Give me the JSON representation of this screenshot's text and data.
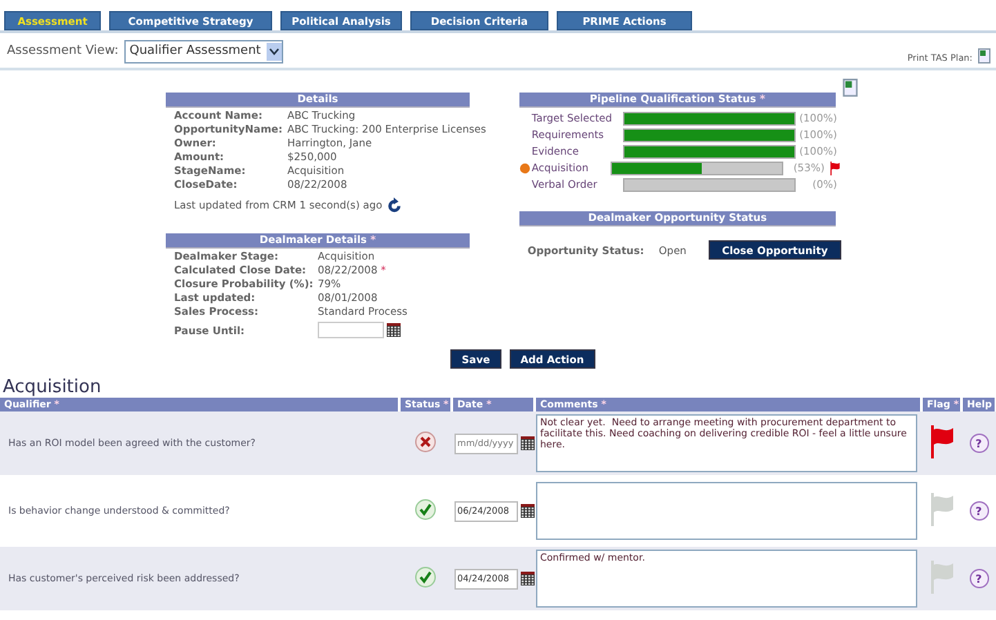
{
  "tabs": [
    {
      "label": "Assessment",
      "selected": true
    },
    {
      "label": "Competitive Strategy",
      "selected": false
    },
    {
      "label": "Political Analysis",
      "selected": false
    },
    {
      "label": "Decision Criteria",
      "selected": false
    },
    {
      "label": "PRIME Actions",
      "selected": false
    }
  ],
  "view": {
    "label": "Assessment View:",
    "value": "Qualifier Assessment"
  },
  "print_label": "Print TAS Plan:",
  "details": {
    "title": "Details",
    "rows": [
      {
        "label": "Account Name:",
        "value": "ABC Trucking"
      },
      {
        "label": "OpportunityName:",
        "value": "ABC Trucking: 200 Enterprise Licenses"
      },
      {
        "label": "Owner:",
        "value": "Harrington, Jane"
      },
      {
        "label": "Amount:",
        "value": "$250,000"
      },
      {
        "label": "StageName:",
        "value": "Acquisition"
      },
      {
        "label": "CloseDate:",
        "value": "08/22/2008"
      }
    ],
    "updated": "Last updated from CRM 1 second(s) ago"
  },
  "dealmaker": {
    "title": "Dealmaker Details",
    "mark": "*",
    "rows": [
      {
        "label": "Dealmaker Stage:",
        "value": "Acquisition",
        "mark": ""
      },
      {
        "label": "Calculated Close Date:",
        "value": "08/22/2008",
        "mark": "*"
      },
      {
        "label": "Closure Probability (%):",
        "value": "79%",
        "mark": ""
      },
      {
        "label": "Last updated:",
        "value": "08/01/2008",
        "mark": ""
      },
      {
        "label": "Sales Process:",
        "value": "Standard Process",
        "mark": ""
      }
    ],
    "pause_label": "Pause Until:"
  },
  "pipeline": {
    "title": "Pipeline Qualification Status",
    "mark": "*",
    "stages": [
      {
        "label": "Target Selected",
        "level": 1,
        "percent": "(100%)",
        "current": false,
        "flagged": false
      },
      {
        "label": "Requirements",
        "level": 1,
        "percent": "(100%)",
        "current": false,
        "flagged": false
      },
      {
        "label": "Evidence",
        "level": 1,
        "percent": "(100%)",
        "current": false,
        "flagged": false
      },
      {
        "label": "Acquisition",
        "level": 0.53,
        "percent": "(53%)",
        "current": true,
        "flagged": true
      },
      {
        "label": "Verbal Order",
        "level": 0,
        "percent": "(0%)",
        "current": false,
        "flagged": false
      }
    ]
  },
  "opportunity": {
    "title": "Dealmaker Opportunity Status",
    "label": "Opportunity Status:",
    "value": "Open",
    "button": "Close Opportunity"
  },
  "buttons": [
    "Save",
    "Add Action"
  ],
  "section_title": "Acquisition",
  "table": {
    "columns": [
      {
        "label": "Qualifier",
        "mark": "*"
      },
      {
        "label": "Status",
        "mark": "*"
      },
      {
        "label": "Date",
        "mark": "*"
      },
      {
        "label": "Comments",
        "mark": "*"
      },
      {
        "label": "Flag",
        "mark": "*"
      },
      {
        "label": "Help"
      }
    ],
    "rows": [
      {
        "qualifier": "Has an ROI model been agreed with the customer?",
        "passed": false,
        "date": "",
        "date_placeholder": "mm/dd/yyyy",
        "comments": "Not clear yet.  Need to arrange meeting with procurement department to facilitate this. Need coaching on delivering credible ROI - feel a little unsure here.",
        "flagged": true,
        "help": "?"
      },
      {
        "qualifier": "Is behavior change understood & committed?",
        "passed": true,
        "date": "06/24/2008",
        "comments": "",
        "flagged": false,
        "help": "?"
      },
      {
        "qualifier": "Has customer's perceived risk been addressed?",
        "passed": true,
        "date": "04/24/2008",
        "comments": "Confirmed w/ mentor.",
        "flagged": false,
        "help": "?"
      }
    ]
  }
}
